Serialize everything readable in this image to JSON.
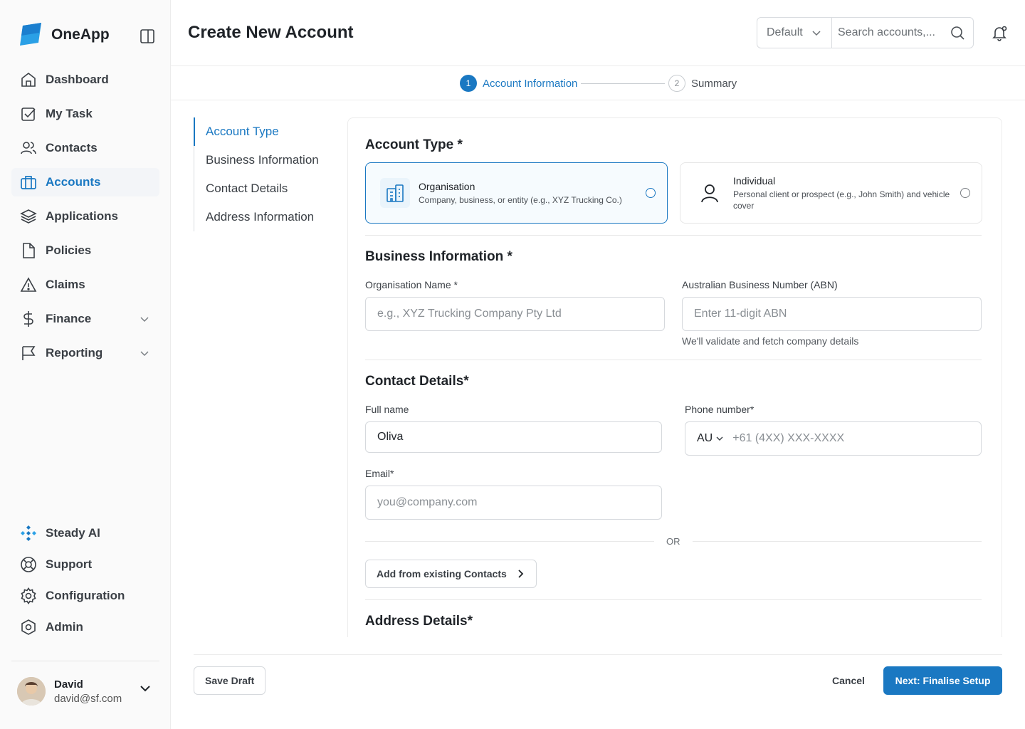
{
  "app": {
    "name": "OneApp"
  },
  "sidebar": {
    "items": [
      {
        "label": "Dashboard",
        "icon": "home-icon"
      },
      {
        "label": "My Task",
        "icon": "checkbox-icon"
      },
      {
        "label": "Contacts",
        "icon": "users-icon"
      },
      {
        "label": "Accounts",
        "icon": "briefcase-icon",
        "active": true
      },
      {
        "label": "Applications",
        "icon": "layers-icon"
      },
      {
        "label": "Policies",
        "icon": "document-icon"
      },
      {
        "label": "Claims",
        "icon": "warning-icon"
      },
      {
        "label": "Finance",
        "icon": "dollar-icon",
        "expandable": true
      },
      {
        "label": "Reporting",
        "icon": "flag-icon",
        "expandable": true
      }
    ],
    "bottom_items": [
      {
        "label": "Steady AI",
        "icon": "ai-icon"
      },
      {
        "label": "Support",
        "icon": "lifebuoy-icon"
      },
      {
        "label": "Configuration",
        "icon": "gear-icon"
      },
      {
        "label": "Admin",
        "icon": "hexagon-icon"
      }
    ],
    "user": {
      "name": "David",
      "email": "david@sf.com"
    }
  },
  "header": {
    "title": "Create New Account",
    "select_value": "Default",
    "search_placeholder": "Search accounts,..."
  },
  "stepper": {
    "steps": [
      {
        "num": "1",
        "label": "Account Information",
        "active": true
      },
      {
        "num": "2",
        "label": "Summary",
        "active": false
      }
    ]
  },
  "section_nav": [
    "Account Type",
    "Business Information",
    "Contact Details",
    "Address Information"
  ],
  "form": {
    "account_type": {
      "title": "Account Type *",
      "options": [
        {
          "title": "Organisation",
          "desc": "Company, business, or entity (e.g., XYZ Trucking Co.)",
          "selected": true
        },
        {
          "title": "Individual",
          "desc": "Personal client or prospect (e.g., John Smith) and vehicle cover",
          "selected": false
        }
      ]
    },
    "business": {
      "title": "Business Information *",
      "org_label": "Organisation Name *",
      "org_placeholder": "e.g., XYZ Trucking Company Pty Ltd",
      "abn_label": "Australian Business Number (ABN)",
      "abn_placeholder": "Enter 11-digit ABN",
      "abn_hint": "We'll validate and fetch company details"
    },
    "contact": {
      "title": "Contact Details*",
      "name_label": "Full name",
      "name_value": "Oliva",
      "phone_label": "Phone number*",
      "phone_country": "AU",
      "phone_placeholder": "+61 (4XX) XXX-XXXX",
      "email_label": "Email*",
      "email_placeholder": "you@company.com",
      "or_text": "OR",
      "add_existing": "Add from existing Contacts"
    },
    "address": {
      "title": "Address Details*"
    }
  },
  "footer": {
    "save_draft": "Save Draft",
    "cancel": "Cancel",
    "next": "Next: Finalise Setup"
  },
  "colors": {
    "accent": "#1a78c2",
    "sidebar_bg": "#fafafa"
  }
}
